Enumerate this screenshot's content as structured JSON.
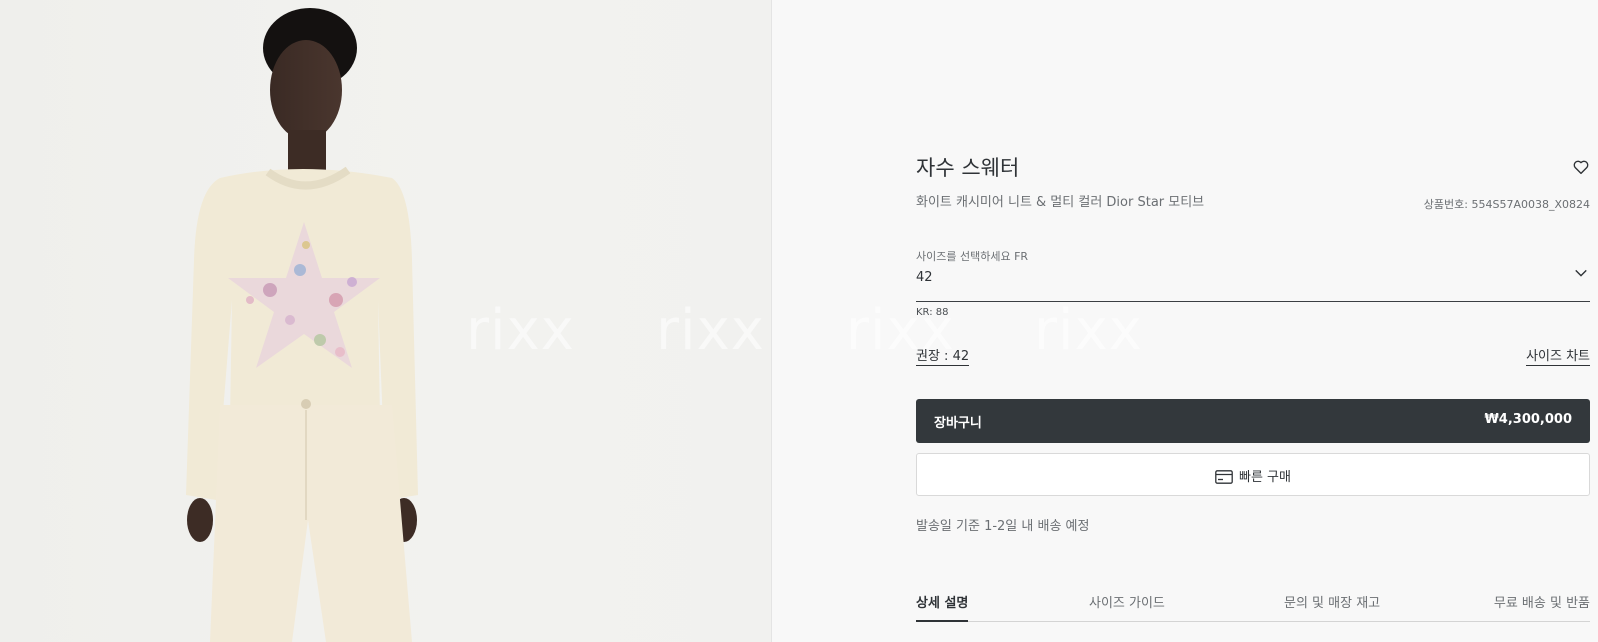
{
  "product": {
    "title": "자수 스웨터",
    "subtitle": "화이트 캐시미어 니트 & 멀티 컬러 Dior Star 모티브",
    "sku": "상품번호: 554S57A0038_X0824",
    "wishlist_icon": "heart-icon"
  },
  "size_selector": {
    "label": "사이즈를 선택하세요 FR",
    "value": "42",
    "kr_equivalent": "KR: 88",
    "recommended": "권장 : 42",
    "size_chart_link": "사이즈 차트",
    "chevron_icon": "chevron-down-icon"
  },
  "actions": {
    "cart_label": "장바구니",
    "cart_price": "₩4,300,000",
    "quick_buy_label": "빠른 구매",
    "quick_buy_icon": "credit-card-icon"
  },
  "shipping_note": "발송일 기준 1-2일 내 배송 예정",
  "tabs": [
    {
      "label": "상세 설명",
      "active": true
    },
    {
      "label": "사이즈 가이드",
      "active": false
    },
    {
      "label": "문의 및 매장 재고",
      "active": false
    },
    {
      "label": "무료 배송 및 반품",
      "active": false
    }
  ],
  "watermark": [
    "rixx",
    "rixx",
    "rixx",
    "rixx"
  ],
  "colors": {
    "primary_button": "#33383c",
    "text_primary": "#2f3337",
    "text_secondary": "#6b6f73",
    "panel_bg": "#f8f8f8"
  }
}
